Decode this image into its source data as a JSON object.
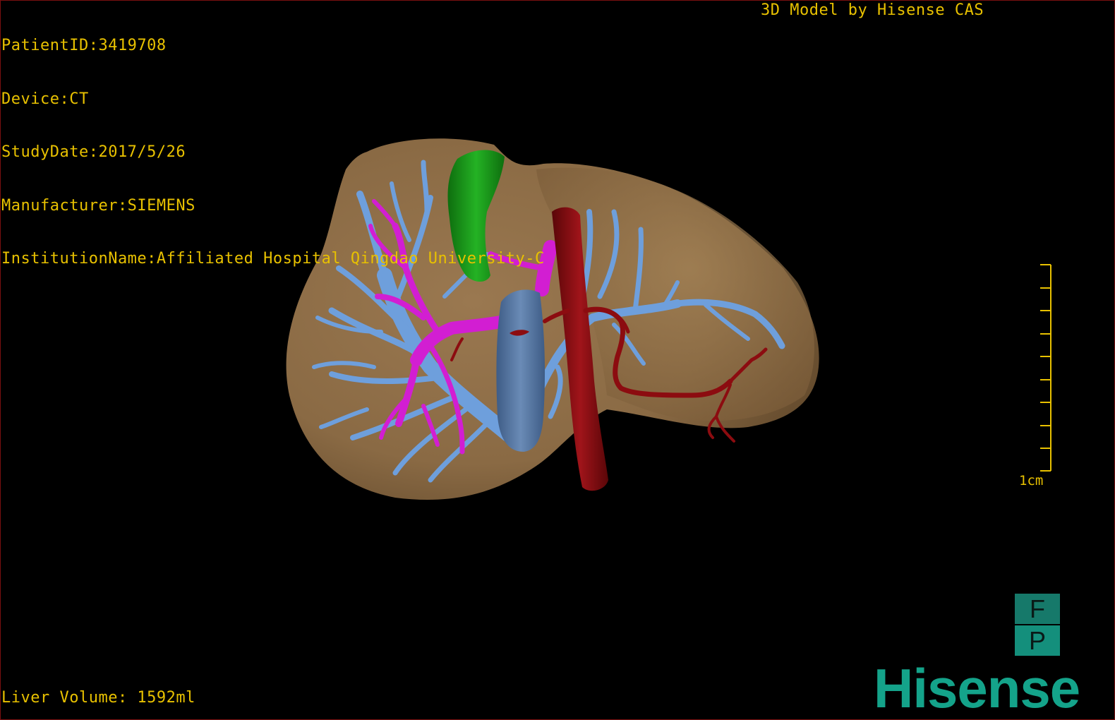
{
  "overlay": {
    "patient_id": "PatientID:3419708",
    "device": "Device:CT",
    "study_date": "StudyDate:2017/5/26",
    "manufacturer": "Manufacturer:SIEMENS",
    "institution": "InstitutionName:Affiliated Hospital Qingdao University-C",
    "model_credit": "3D Model by Hisense CAS",
    "liver_volume": "Liver Volume: 1592ml"
  },
  "scale": {
    "label": "1cm"
  },
  "orientation_cube": {
    "top_label": "F",
    "bottom_label": "P"
  },
  "brand": {
    "logo_text": "Hisense"
  },
  "colors": {
    "hud_text": "#e8c100",
    "background": "#000000",
    "liver": "#8a6a44",
    "hepatic_veins": "#6e9fdc",
    "portal_vein": "#d21ed2",
    "gallbladder": "#1e9c1e",
    "ivc": "#56779f",
    "artery": "#8c0c10",
    "brand": "#14a38a"
  }
}
